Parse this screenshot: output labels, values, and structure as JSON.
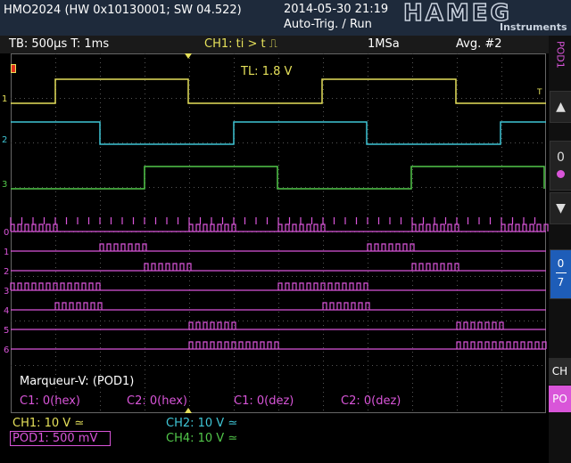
{
  "header": {
    "device": "HMO2024 (HW 0x10130001; SW 04.522)",
    "datetime": "2014-05-30 21:19",
    "trigger_state": "Auto-Trig. / Run",
    "brand": "HAMEG",
    "brand_sub": "Instruments"
  },
  "status": {
    "timebase": "TB: 500µs  T: 1ms",
    "trigger": "CH1: ti > t ⎍",
    "samplerate": "1MSa",
    "averaging": "Avg. #2"
  },
  "screen": {
    "trigger_level": "TL: 1.8 V",
    "trigger_marker": "T",
    "marker_title": "Marqueur-V: (POD1)",
    "readouts": [
      "C1: 0(hex)",
      "C2: 0(hex)",
      "C1: 0(dez)",
      "C2: 0(dez)"
    ],
    "analog_labels": [
      "1",
      "2",
      "3"
    ],
    "digital_labels": [
      "0",
      "1",
      "2",
      "3",
      "4",
      "5",
      "6"
    ]
  },
  "sidebar": {
    "pod_label": "POD1",
    "level_zero": "0",
    "range_top": "0",
    "range_bottom": "7",
    "ch_tab": "CH",
    "po_tab": "PO"
  },
  "bottom": {
    "ch1": "CH1: 10 V ≃",
    "ch2": "CH2: 10 V ≃",
    "pod1": "POD1: 500 mV",
    "ch4": "CH4: 10 V ≃"
  },
  "colors": {
    "ch1": "#e5e05a",
    "ch2": "#3fc6d6",
    "ch4": "#52c84a",
    "pod": "#d955d9",
    "accent_blue": "#1e5db8",
    "header_bg": "#1e2a3b"
  }
}
